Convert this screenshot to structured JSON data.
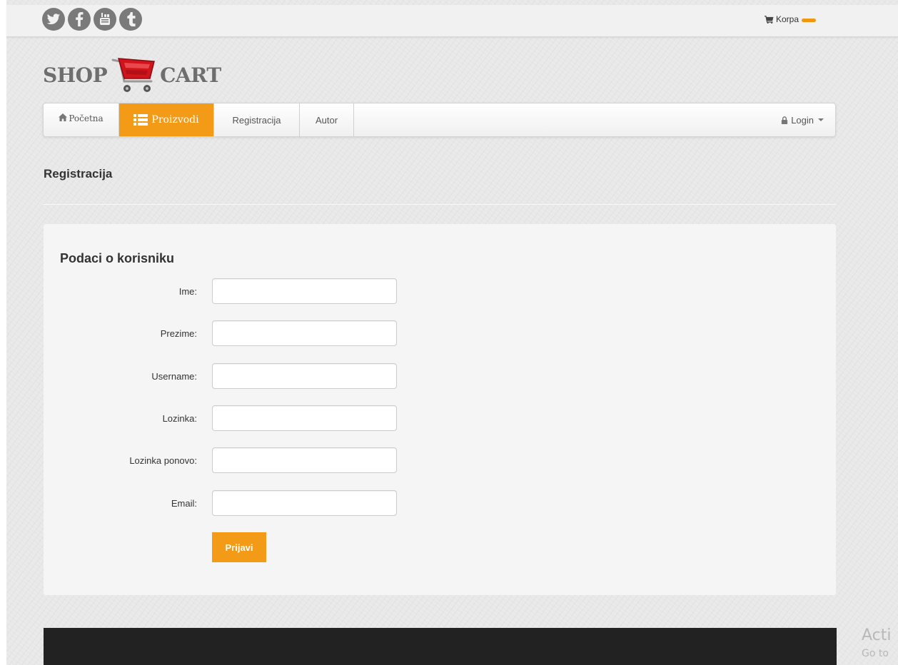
{
  "topbar": {
    "social_icons": [
      "twitter-icon",
      "facebook-icon",
      "youtube-icon",
      "tumblr-icon"
    ],
    "cart_label": "Korpa",
    "cart_badge_color": "#f0960f"
  },
  "logo": {
    "word_left": "SHOP",
    "word_right": "CART",
    "cart_icon_color": "#d0141c"
  },
  "navbar": {
    "home_label": "Početna",
    "products_label": "Proizvodi",
    "register_label": "Registracija",
    "author_label": "Autor",
    "login_label": "Login",
    "active_color": "#f39a17"
  },
  "page": {
    "title": "Registracija"
  },
  "form": {
    "section_title": "Podaci o korisniku",
    "fields": [
      {
        "label": "Ime:",
        "value": ""
      },
      {
        "label": "Prezime:",
        "value": ""
      },
      {
        "label": "Username:",
        "value": ""
      },
      {
        "label": "Lozinka:",
        "value": ""
      },
      {
        "label": "Lozinka ponovo:",
        "value": ""
      },
      {
        "label": "Email:",
        "value": ""
      }
    ],
    "submit_label": "Prijavi"
  },
  "watermark": {
    "line1": "Acti",
    "line2": "Go to"
  }
}
